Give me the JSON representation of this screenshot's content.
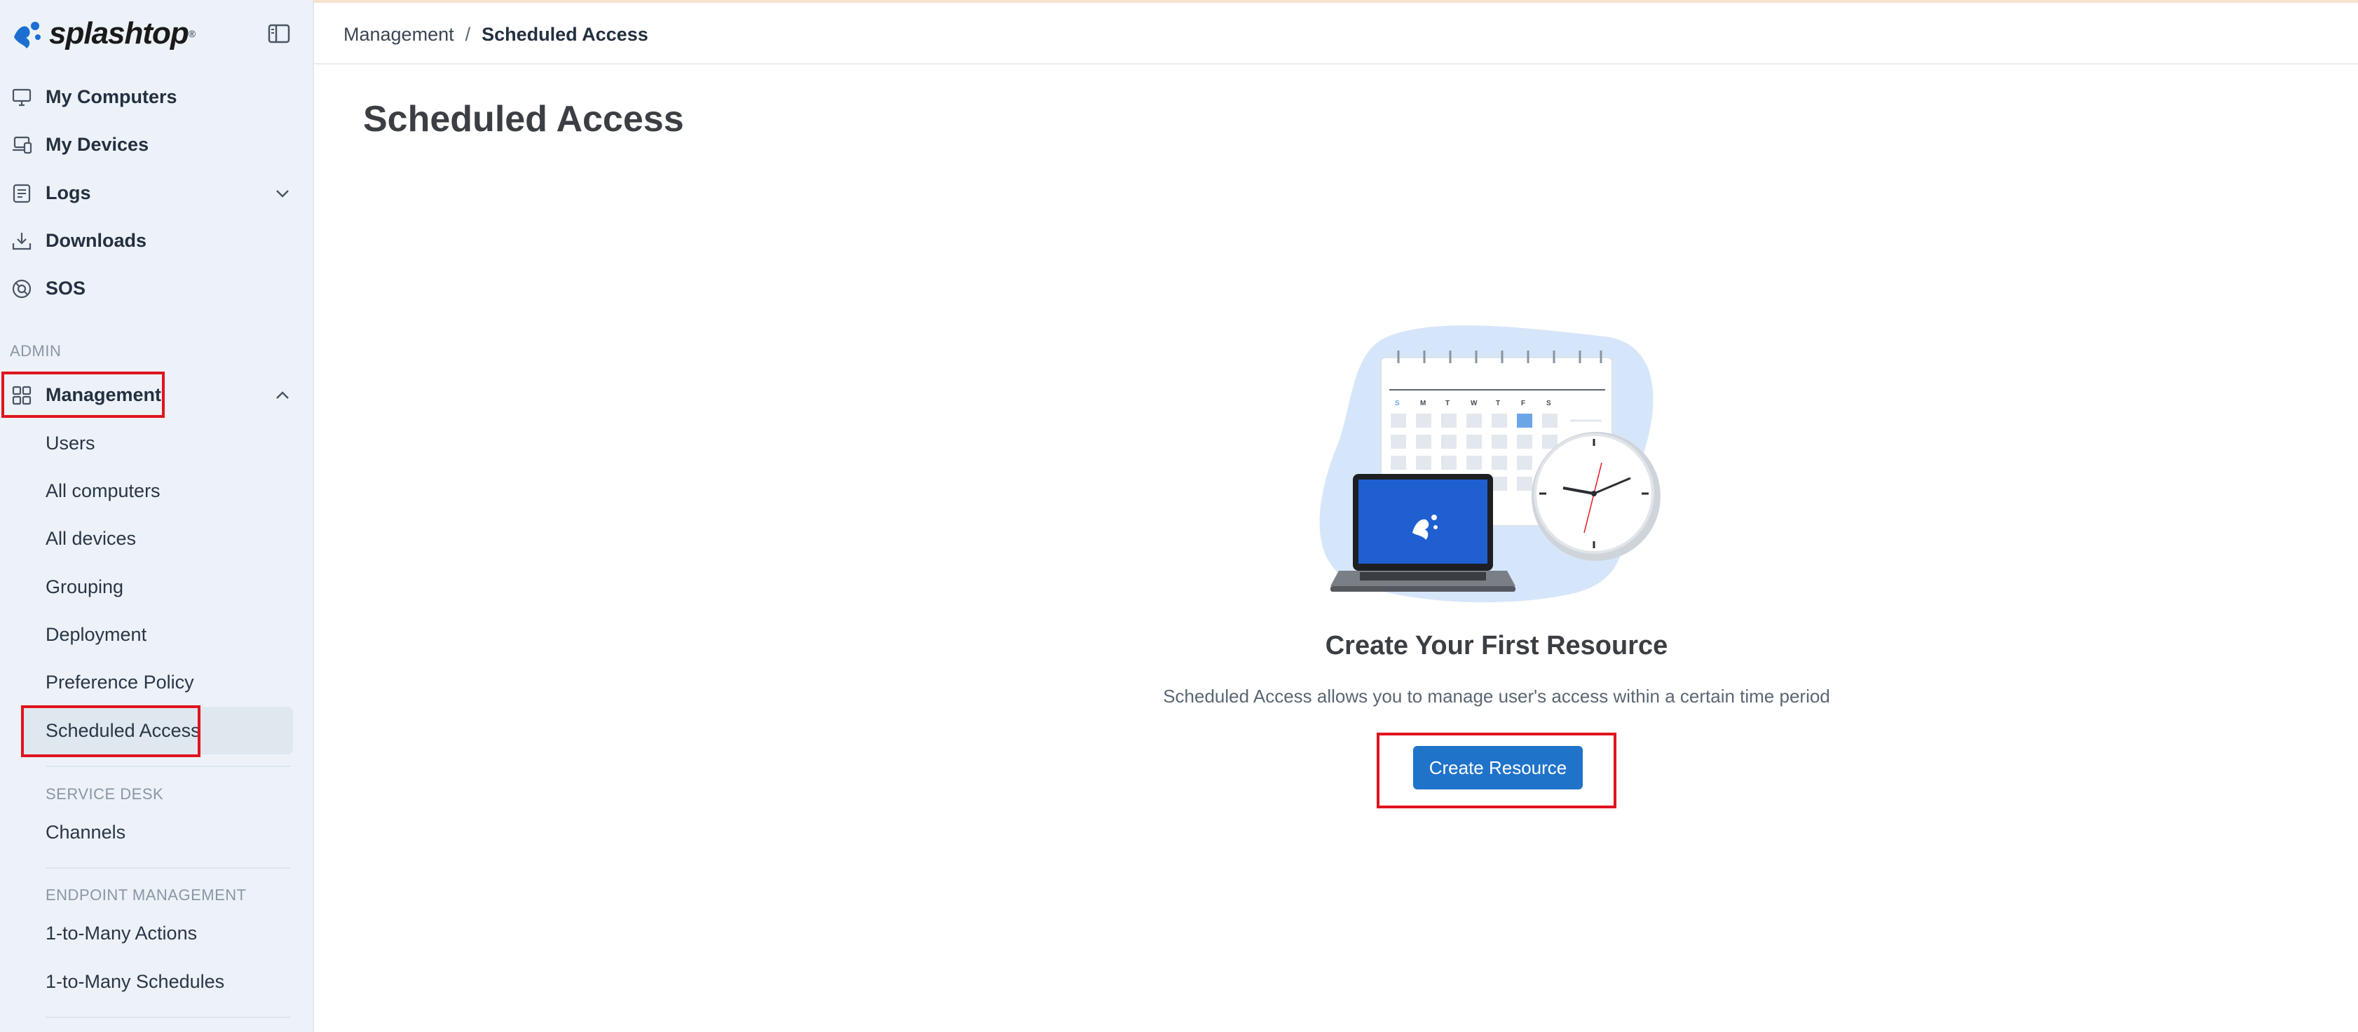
{
  "brand": {
    "name": "splashtop",
    "accent": "#1f73c9",
    "highlight": "#e0141e"
  },
  "sidebar": {
    "top_items": [
      {
        "label": "My Computers",
        "icon": "monitor-icon"
      },
      {
        "label": "My Devices",
        "icon": "devices-icon"
      },
      {
        "label": "Logs",
        "icon": "logs-icon",
        "expanded": false
      },
      {
        "label": "Downloads",
        "icon": "download-icon"
      },
      {
        "label": "SOS",
        "icon": "sos-icon"
      }
    ],
    "admin_title": "ADMIN",
    "management": {
      "label": "Management",
      "icon": "grid-icon",
      "expanded": true
    },
    "management_items": [
      "Users",
      "All computers",
      "All devices",
      "Grouping",
      "Deployment",
      "Preference Policy",
      "Scheduled Access"
    ],
    "active_item": "Scheduled Access",
    "service_desk_title": "SERVICE DESK",
    "service_desk_items": [
      "Channels"
    ],
    "endpoint_title": "ENDPOINT MANAGEMENT",
    "endpoint_items": [
      "1-to-Many Actions",
      "1-to-Many Schedules"
    ]
  },
  "breadcrumb": {
    "parent": "Management",
    "separator": "/",
    "current": "Scheduled Access"
  },
  "page_title": "Scheduled Access",
  "empty_state": {
    "title": "Create Your First Resource",
    "description": "Scheduled Access allows you to manage user's access within a certain time period",
    "button_label": "Create Resource",
    "calendar_days": [
      "S",
      "M",
      "T",
      "W",
      "T",
      "F",
      "S"
    ]
  }
}
